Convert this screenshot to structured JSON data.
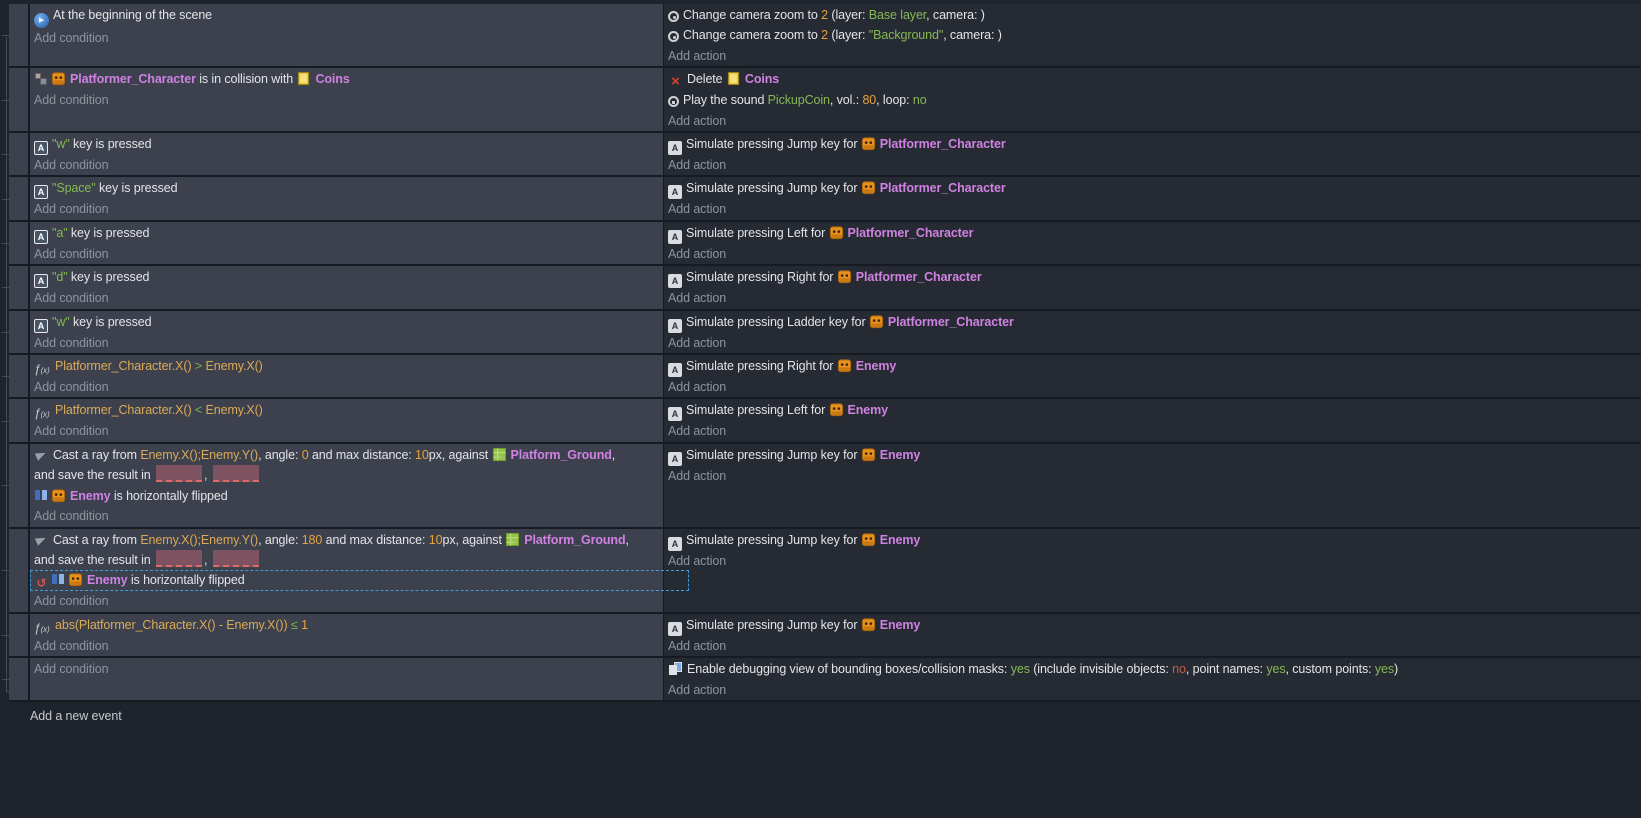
{
  "labels": {
    "add_condition": "Add condition",
    "add_action": "Add action",
    "add_new_event": "Add a new event"
  },
  "colors": {
    "object_name": "#cf82e2",
    "string_value": "#85b955",
    "number_value": "#e8a33d",
    "expression": "#dcaa57",
    "selection": "#3f9bdc",
    "tab_highlight": "#5b41d6"
  },
  "events": [
    {
      "conditions": [
        {
          "ic": [
            "scene-begin-icon"
          ],
          "seg": [
            [
              "t",
              "At the beginning of the scene"
            ]
          ]
        }
      ],
      "actions": [
        {
          "ic": [
            "camera-icon"
          ],
          "seg": [
            [
              "t",
              "Change camera zoom to "
            ],
            [
              "n",
              "2"
            ],
            [
              "t",
              " (layer: "
            ],
            [
              "s",
              "Base layer"
            ],
            [
              "t",
              ", camera: )"
            ]
          ]
        },
        {
          "ic": [
            "camera-icon"
          ],
          "seg": [
            [
              "t",
              "Change camera zoom to "
            ],
            [
              "n",
              "2"
            ],
            [
              "t",
              " (layer: "
            ],
            [
              "s",
              "\"Background\""
            ],
            [
              "t",
              ", camera: )"
            ]
          ]
        }
      ]
    },
    {
      "conditions": [
        {
          "ic": [
            "collision-icon",
            "character-object-icon"
          ],
          "seg": [
            [
              "obj",
              "Platformer_Character"
            ],
            [
              "t",
              " is in collision with "
            ],
            [
              "i",
              "coins-object-icon"
            ],
            [
              "obj",
              "Coins"
            ]
          ]
        }
      ],
      "actions": [
        {
          "ic": [
            "delete-icon"
          ],
          "seg": [
            [
              "t",
              "Delete "
            ],
            [
              "i",
              "coins-object-icon"
            ],
            [
              "obj",
              "Coins"
            ]
          ]
        },
        {
          "ic": [
            "sound-icon"
          ],
          "seg": [
            [
              "t",
              "Play the sound "
            ],
            [
              "s",
              "PickupCoin"
            ],
            [
              "t",
              ", vol.: "
            ],
            [
              "n",
              "80"
            ],
            [
              "t",
              ", loop: "
            ],
            [
              "s",
              "no"
            ]
          ]
        }
      ]
    },
    {
      "conditions": [
        {
          "ic": [
            "keyboard-icon"
          ],
          "seg": [
            [
              "s",
              "\"w\""
            ],
            [
              "t",
              " key is pressed"
            ]
          ]
        }
      ],
      "actions": [
        {
          "ic": [
            "keyboard-sim-icon"
          ],
          "seg": [
            [
              "t",
              "Simulate pressing Jump key for "
            ],
            [
              "i",
              "character-object-icon"
            ],
            [
              "obj",
              "Platformer_Character"
            ]
          ]
        }
      ]
    },
    {
      "conditions": [
        {
          "ic": [
            "keyboard-icon"
          ],
          "seg": [
            [
              "s",
              "\"Space\""
            ],
            [
              "t",
              " key is pressed"
            ]
          ]
        }
      ],
      "actions": [
        {
          "ic": [
            "keyboard-sim-icon"
          ],
          "seg": [
            [
              "t",
              "Simulate pressing Jump key for "
            ],
            [
              "i",
              "character-object-icon"
            ],
            [
              "obj",
              "Platformer_Character"
            ]
          ]
        }
      ]
    },
    {
      "conditions": [
        {
          "ic": [
            "keyboard-icon"
          ],
          "seg": [
            [
              "s",
              "\"a\""
            ],
            [
              "t",
              " key is pressed"
            ]
          ]
        }
      ],
      "actions": [
        {
          "ic": [
            "keyboard-sim-icon"
          ],
          "seg": [
            [
              "t",
              "Simulate pressing Left for "
            ],
            [
              "i",
              "character-object-icon"
            ],
            [
              "obj",
              "Platformer_Character"
            ]
          ]
        }
      ]
    },
    {
      "conditions": [
        {
          "ic": [
            "keyboard-icon"
          ],
          "seg": [
            [
              "s",
              "\"d\""
            ],
            [
              "t",
              " key is pressed"
            ]
          ]
        }
      ],
      "actions": [
        {
          "ic": [
            "keyboard-sim-icon"
          ],
          "seg": [
            [
              "t",
              "Simulate pressing Right for "
            ],
            [
              "i",
              "character-object-icon"
            ],
            [
              "obj",
              "Platformer_Character"
            ]
          ]
        }
      ]
    },
    {
      "conditions": [
        {
          "ic": [
            "keyboard-icon"
          ],
          "seg": [
            [
              "s",
              "\"w\""
            ],
            [
              "t",
              " key is pressed"
            ]
          ]
        }
      ],
      "actions": [
        {
          "ic": [
            "keyboard-sim-icon"
          ],
          "seg": [
            [
              "t",
              "Simulate pressing Ladder key for "
            ],
            [
              "i",
              "character-object-icon"
            ],
            [
              "obj",
              "Platformer_Character"
            ]
          ]
        }
      ]
    },
    {
      "conditions": [
        {
          "ic": [
            "function-icon"
          ],
          "seg": [
            [
              "e",
              "Platformer_Character.X()"
            ],
            [
              "o",
              "  >  "
            ],
            [
              "e",
              "Enemy.X()"
            ]
          ]
        }
      ],
      "actions": [
        {
          "ic": [
            "keyboard-sim-icon"
          ],
          "seg": [
            [
              "t",
              "Simulate pressing Right for "
            ],
            [
              "i",
              "character-object-icon"
            ],
            [
              "obj",
              "Enemy"
            ]
          ]
        }
      ]
    },
    {
      "conditions": [
        {
          "ic": [
            "function-icon"
          ],
          "seg": [
            [
              "e",
              "Platformer_Character.X()"
            ],
            [
              "o",
              "  <  "
            ],
            [
              "e",
              "Enemy.X()"
            ]
          ]
        }
      ],
      "actions": [
        {
          "ic": [
            "keyboard-sim-icon"
          ],
          "seg": [
            [
              "t",
              "Simulate pressing Left for "
            ],
            [
              "i",
              "character-object-icon"
            ],
            [
              "obj",
              "Enemy"
            ]
          ]
        }
      ]
    },
    {
      "conditions": [
        {
          "ic": [
            "raycast-icon"
          ],
          "seg": [
            [
              "t",
              "Cast a ray from "
            ],
            [
              "e",
              "Enemy.X();Enemy.Y()"
            ],
            [
              "t",
              ", angle: "
            ],
            [
              "n",
              "0"
            ],
            [
              "t",
              " and max distance: "
            ],
            [
              "n",
              "10"
            ],
            [
              "t",
              "px, against "
            ],
            [
              "i",
              "ground-object-icon"
            ],
            [
              "obj",
              "Platform_Ground"
            ],
            [
              "t",
              ","
            ]
          ]
        },
        {
          "seg": [
            [
              "t",
              "and save the result in "
            ],
            [
              "box",
              ""
            ],
            [
              "t",
              ", "
            ],
            [
              "box",
              ""
            ]
          ]
        },
        {
          "ic": [
            "flip-icon",
            "character-object-icon"
          ],
          "seg": [
            [
              "obj",
              "Enemy"
            ],
            [
              "t",
              " is horizontally flipped"
            ]
          ]
        }
      ],
      "actions": [
        {
          "ic": [
            "keyboard-sim-icon"
          ],
          "seg": [
            [
              "t",
              "Simulate pressing Jump key for "
            ],
            [
              "i",
              "character-object-icon"
            ],
            [
              "obj",
              "Enemy"
            ]
          ]
        }
      ]
    },
    {
      "conditions": [
        {
          "ic": [
            "raycast-icon"
          ],
          "seg": [
            [
              "t",
              "Cast a ray from "
            ],
            [
              "e",
              "Enemy.X();Enemy.Y()"
            ],
            [
              "t",
              ", angle: "
            ],
            [
              "n",
              "180"
            ],
            [
              "t",
              " and max distance: "
            ],
            [
              "n",
              "10"
            ],
            [
              "t",
              "px, against "
            ],
            [
              "i",
              "ground-object-icon"
            ],
            [
              "obj",
              "Platform_Ground"
            ],
            [
              "t",
              ","
            ]
          ]
        },
        {
          "seg": [
            [
              "t",
              "and save the result in "
            ],
            [
              "box",
              ""
            ],
            [
              "t",
              ", "
            ],
            [
              "box",
              ""
            ]
          ]
        },
        {
          "ic": [
            "not-icon",
            "flip-icon",
            "character-object-icon"
          ],
          "seg": [
            [
              "obj",
              "Enemy"
            ],
            [
              "t",
              " is horizontally flipped"
            ]
          ],
          "sel": true
        }
      ],
      "actions": [
        {
          "ic": [
            "keyboard-sim-icon"
          ],
          "seg": [
            [
              "t",
              "Simulate pressing Jump key for "
            ],
            [
              "i",
              "character-object-icon"
            ],
            [
              "obj",
              "Enemy"
            ]
          ]
        }
      ]
    },
    {
      "conditions": [
        {
          "ic": [
            "function-icon"
          ],
          "seg": [
            [
              "e",
              "abs(Platformer_Character.X() - Enemy.X())"
            ],
            [
              "o",
              "  ≤  "
            ],
            [
              "n",
              "1"
            ]
          ]
        }
      ],
      "actions": [
        {
          "ic": [
            "keyboard-sim-icon"
          ],
          "seg": [
            [
              "t",
              "Simulate pressing Jump key for "
            ],
            [
              "i",
              "character-object-icon"
            ],
            [
              "obj",
              "Enemy"
            ]
          ]
        }
      ]
    },
    {
      "conditions": [],
      "actions": [
        {
          "ic": [
            "debug-icon"
          ],
          "seg": [
            [
              "t",
              "Enable debugging view of bounding boxes/collision masks: "
            ],
            [
              "s",
              "yes"
            ],
            [
              "t",
              " (include invisible objects: "
            ],
            [
              "r",
              "no"
            ],
            [
              "t",
              ", point names: "
            ],
            [
              "s",
              "yes"
            ],
            [
              "t",
              ", custom points: "
            ],
            [
              "s",
              "yes"
            ],
            [
              "t",
              ")"
            ]
          ]
        }
      ]
    }
  ]
}
